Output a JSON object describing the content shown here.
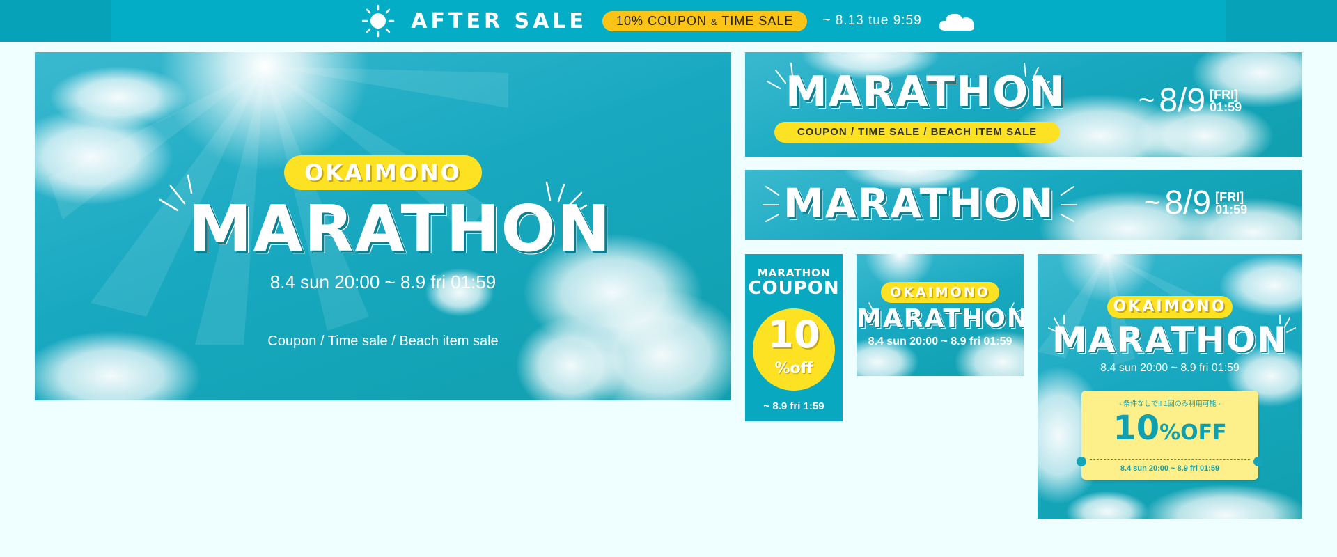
{
  "topbar": {
    "title": "AFTER SALE",
    "coupon_pre": "10% COUPON ",
    "coupon_amp": "&",
    "coupon_post": " TIME SALE",
    "date": "~ 8.13 tue 9:59",
    "icons": {
      "left": "sun-icon",
      "right": "cloud-icon"
    },
    "colors": {
      "bar": "#03adc6",
      "pill": "#fcc417"
    }
  },
  "main_banner": {
    "okaimono": "OKAIMONO",
    "marathon": "MARATHON",
    "period": "8.4 sun 20:00 ~ 8.9 fri 01:59",
    "features": "Coupon / Time sale / Beach item sale"
  },
  "wide_banner_1": {
    "marathon": "MARATHON",
    "features": "COUPON  /  TIME SALE  /  BEACH ITEM SALE",
    "tilde": "~",
    "date": "8/9",
    "weekday": "[FRI]",
    "time": "01:59"
  },
  "wide_banner_2": {
    "marathon": "MARATHON",
    "tilde": "~",
    "date": "8/9",
    "weekday": "[FRI]",
    "time": "01:59"
  },
  "coupon_banner": {
    "title1": "MARATHON",
    "title2": "COUPON",
    "value": "10",
    "unit": "%off",
    "date": "~ 8.9 fri 1:59"
  },
  "small_banner": {
    "okaimono": "OKAIMONO",
    "marathon": "MARATHON",
    "period": "8.4 sun 20:00 ~ 8.9 fri 01:59"
  },
  "tall_banner": {
    "okaimono": "OKAIMONO",
    "marathon": "MARATHON",
    "period": "8.4 sun 20:00 ~ 8.9 fri 01:59",
    "ticket_note": "- 条件なしで!! 1回のみ利用可能 -",
    "ticket_value": "10",
    "ticket_unit": "%OFF",
    "ticket_period": "8.4 sun 20:00 ~ 8.9 fri 01:59"
  },
  "colors": {
    "page_bg": "#effeff",
    "banner_teal": "#18a9c1",
    "yellow": "#fde224",
    "ticket": "#fdf08a"
  }
}
